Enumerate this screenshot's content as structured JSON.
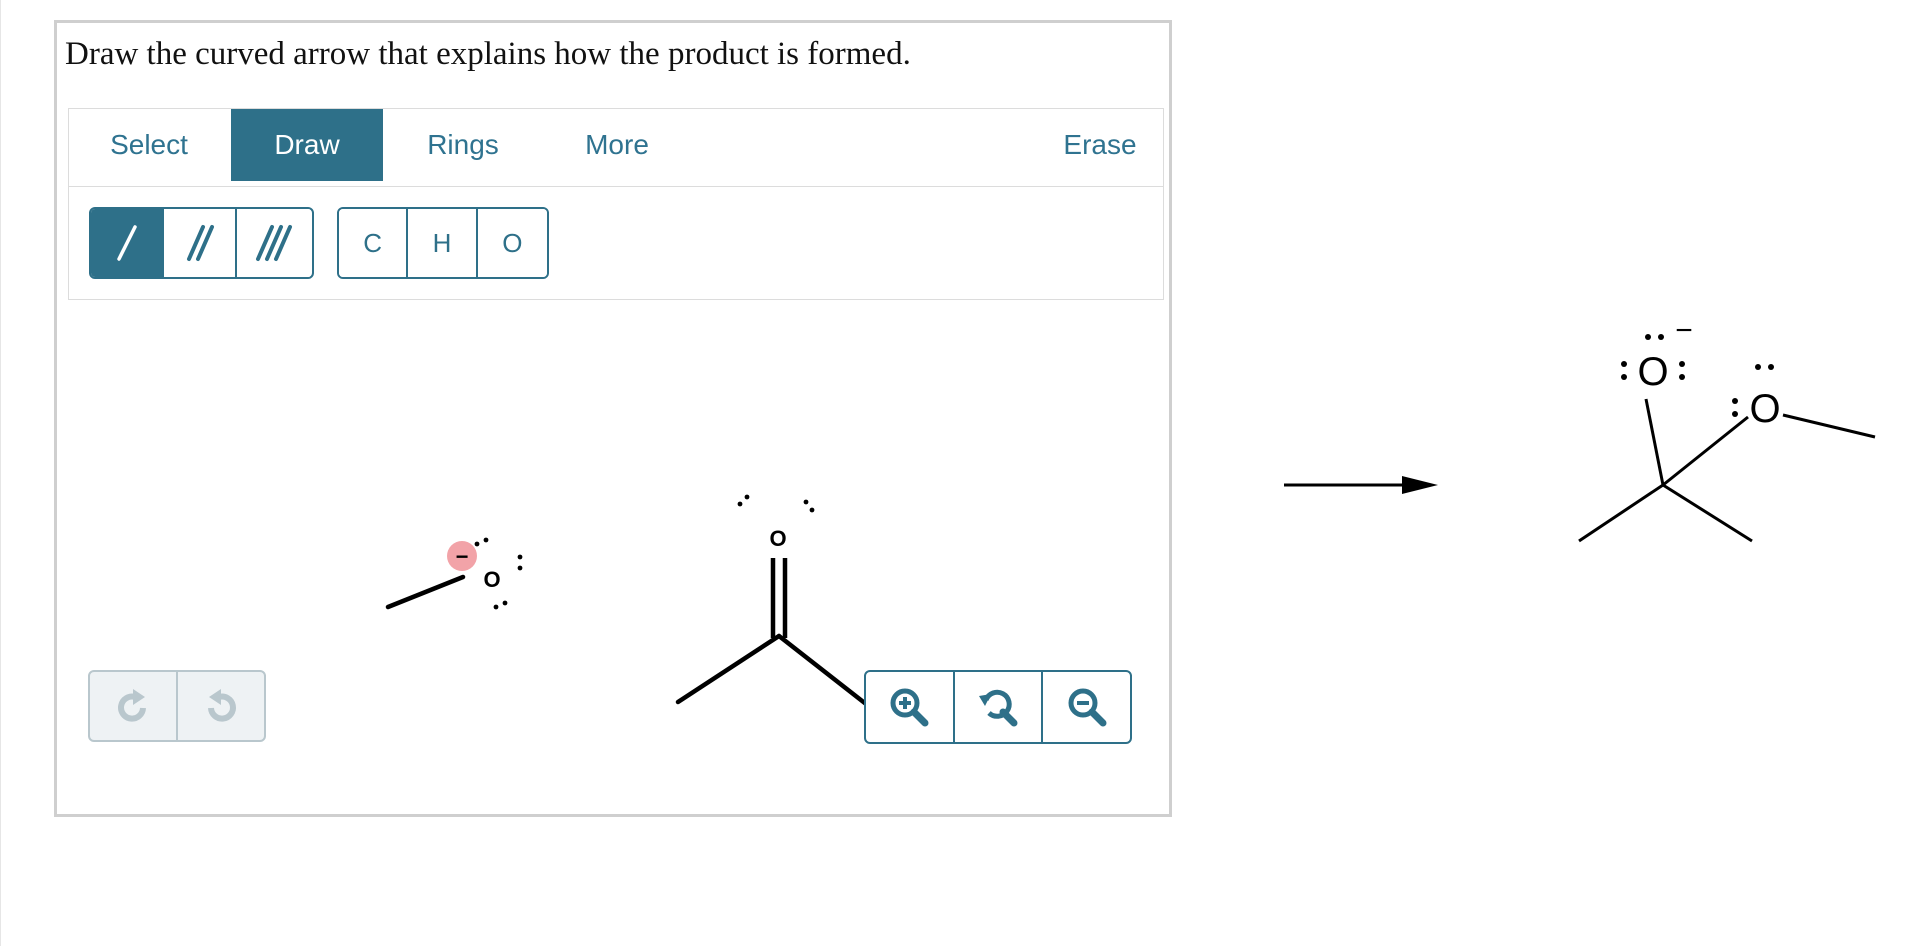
{
  "question": {
    "prompt": "Draw the curved arrow that explains how the product is formed."
  },
  "toolbar": {
    "tabs": [
      {
        "label": "Select",
        "active": false
      },
      {
        "label": "Draw",
        "active": true
      },
      {
        "label": "Rings",
        "active": false
      },
      {
        "label": "More",
        "active": false
      },
      {
        "label": "Erase",
        "active": false
      }
    ],
    "bond_tools": [
      {
        "icon": "single-bond-icon",
        "active": true
      },
      {
        "icon": "double-bond-icon",
        "active": false
      },
      {
        "icon": "triple-bond-icon",
        "active": false
      }
    ],
    "atom_tools": [
      {
        "label": "C"
      },
      {
        "label": "H"
      },
      {
        "label": "O"
      }
    ]
  },
  "canvas": {
    "methoxide_atom": "O",
    "methoxide_charge": "−",
    "acetone_atom": "O"
  },
  "history": {
    "undo_icon": "undo-icon",
    "redo_icon": "redo-icon"
  },
  "zoom": {
    "zoom_in_icon": "zoom-in-icon",
    "zoom_reset_icon": "zoom-reset-icon",
    "zoom_out_icon": "zoom-out-icon"
  },
  "product": {
    "alkoxide_atom": "O",
    "alkoxide_charge": "−",
    "ether_atom": "O"
  },
  "colors": {
    "accent": "#2e7089",
    "charge_highlight": "#f2a3a8",
    "disabled": "#b9c7cd"
  }
}
